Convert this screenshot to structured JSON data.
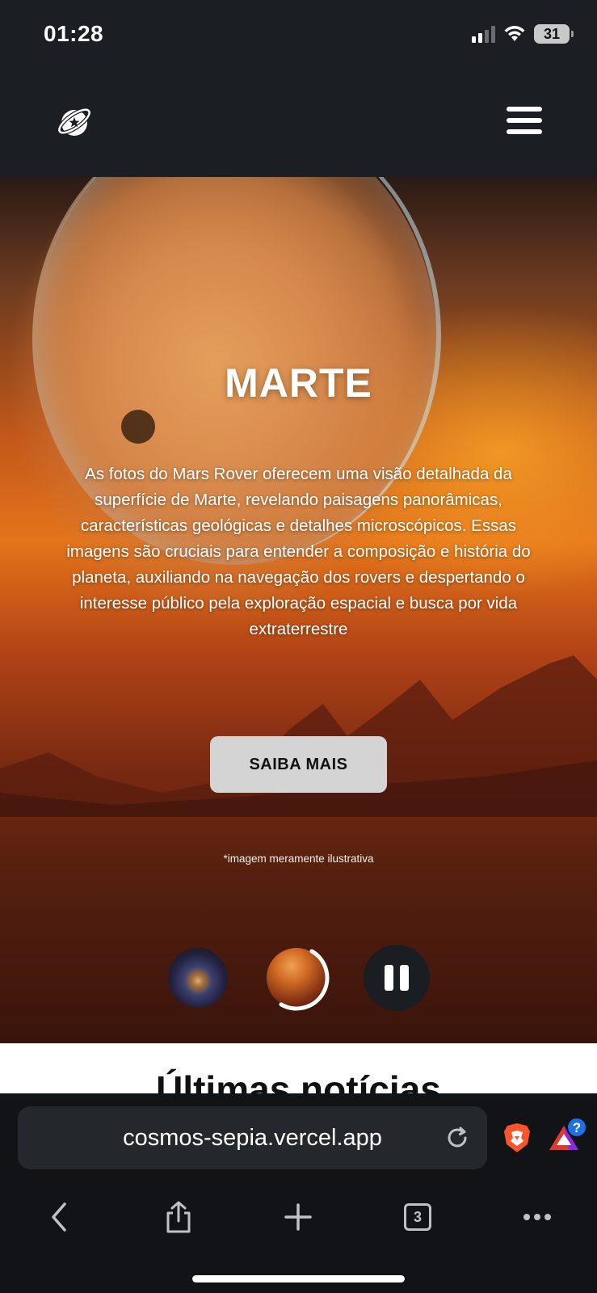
{
  "status_bar": {
    "time": "01:28",
    "battery": "31",
    "icons": [
      "signal-icon",
      "wifi-icon",
      "battery-icon"
    ]
  },
  "header": {
    "logo_icon": "planet-logo-icon",
    "menu_icon": "hamburger-menu-icon"
  },
  "hero": {
    "title": "MARTE",
    "description": "As fotos do Mars Rover oferecem uma visão detalhada da superfície de Marte, revelando paisagens panorâmicas, características geológicas e detalhes microscópicos. Essas imagens são cruciais para entender a composição e história do planeta, auxiliando na navegação dos rovers e despertando o interesse público pela exploração espacial e busca por vida extraterrestre",
    "cta_label": "SAIBA MAIS",
    "disclaimer": "*imagem meramente ilustrativa",
    "slides": [
      "galaxy-thumbnail",
      "mars-thumbnail"
    ],
    "active_slide": 1,
    "slide_progress": 0.5
  },
  "news": {
    "title": "Últimas notícias"
  },
  "browser": {
    "url": "cosmos-sepia.vercel.app",
    "tab_count": "3",
    "badge": "?",
    "colors": {
      "chrome_bg": "#111316",
      "url_bg": "#24272c",
      "brave_orange": "#fb542b"
    }
  }
}
